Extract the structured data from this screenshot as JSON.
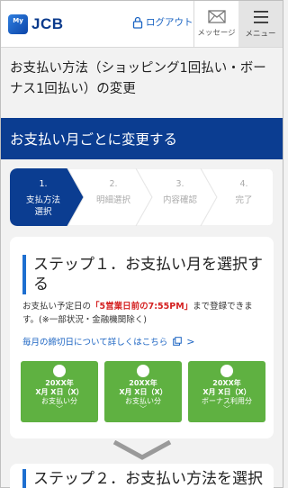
{
  "header": {
    "logo_badge": "My",
    "logo_text": "JCB",
    "logout_label": "ログアウト",
    "message_label": "メッセージ",
    "menu_label": "メニュー"
  },
  "page_title": "お支払い方法（ショッピング1回払い・ボーナス1回払い）の変更",
  "banner": "お支払い月ごとに変更する",
  "steps": [
    {
      "num": "1.",
      "label": "支払方法\n選択",
      "active": true
    },
    {
      "num": "2.",
      "label": "明細選択",
      "active": false
    },
    {
      "num": "3.",
      "label": "内容確認",
      "active": false
    },
    {
      "num": "4.",
      "label": "完了",
      "active": false
    }
  ],
  "step1": {
    "heading": "ステップ１．お支払い月を選択する",
    "desc_before": "お支払い予定日の",
    "desc_highlight": "「5営業日前の7:55PM」",
    "desc_after": "まで登録できます。(※一部状況・金融機関除く)",
    "link": "毎月の締切日について詳しくはこちら"
  },
  "tiles": [
    {
      "line1": "20XX年",
      "line2": "X月 X日（X）",
      "line3": "お支払い分"
    },
    {
      "line1": "20XX年",
      "line2": "X月 X日（X）",
      "line3": "お支払い分"
    },
    {
      "line1": "20XX年",
      "line2": "X月 X日（X）",
      "line3": "ボーナス利用分"
    }
  ],
  "step2": {
    "heading": "ステップ２．お支払い方法を選択"
  },
  "colors": {
    "brand_blue": "#0b3d91",
    "accent_blue": "#1e6fd0",
    "tile_green": "#5fb141",
    "highlight_red": "#d42020"
  }
}
